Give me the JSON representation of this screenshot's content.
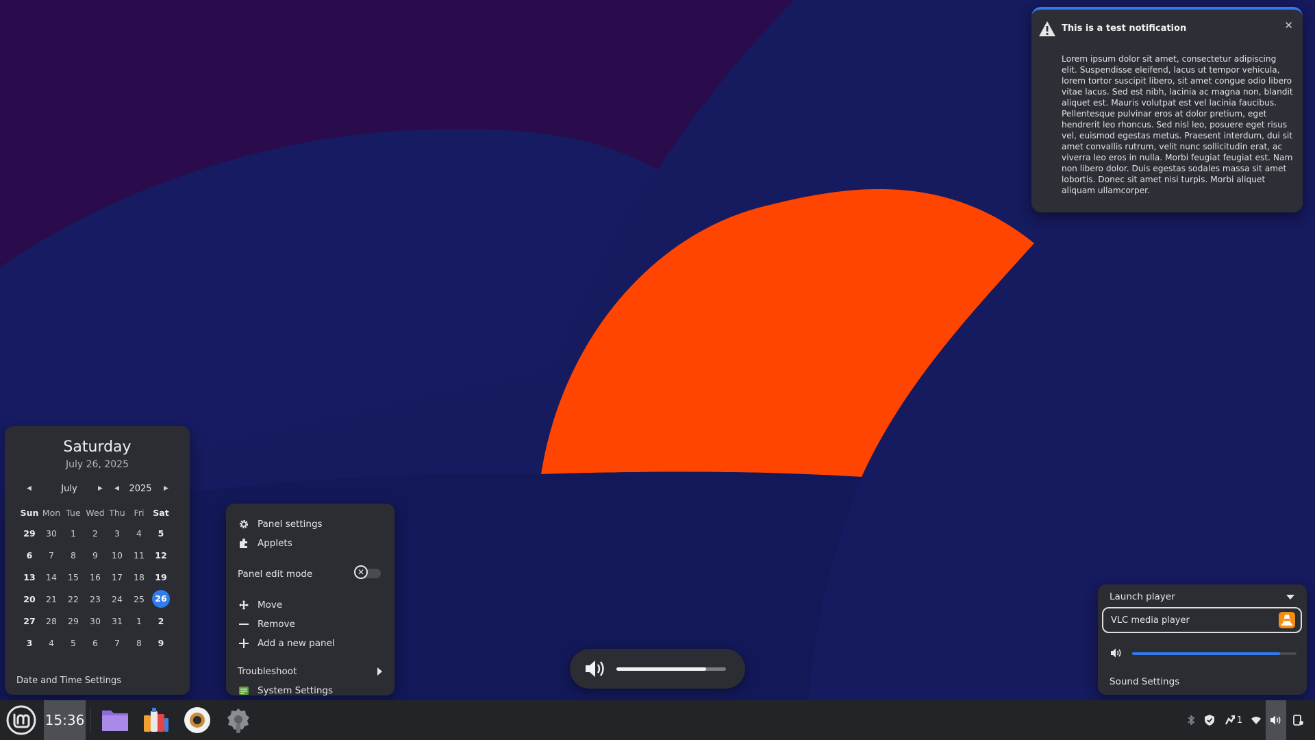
{
  "notification": {
    "title": "This is a test notification",
    "close": "✕",
    "body": "Lorem ipsum dolor sit amet, consectetur adipiscing elit. Suspendisse eleifend, lacus ut tempor vehicula, lorem tortor suscipit libero, sit amet congue odio libero vitae lacus. Sed est nibh, lacinia ac magna non, blandit aliquet est. Mauris volutpat est vel lacinia faucibus. Pellentesque pulvinar eros at dolor pretium, eget hendrerit leo rhoncus. Sed nisl leo, posuere eget risus vel, euismod egestas metus. Praesent interdum, dui sit amet convallis rutrum, velit nunc sollicitudin erat, ac viverra leo eros in nulla. Morbi feugiat feugiat est. Nam non libero dolor. Duis egestas sodales massa sit amet lobortis. Donec sit amet nisi turpis. Morbi aliquet aliquam ullamcorper.",
    "accent": "#2f7cf0"
  },
  "calendar": {
    "weekday": "Saturday",
    "date": "July 26, 2025",
    "month": "July",
    "year": "2025",
    "day_headers": [
      "Sun",
      "Mon",
      "Tue",
      "Wed",
      "Thu",
      "Fri",
      "Sat"
    ],
    "weeks": [
      [
        "29",
        "30",
        "1",
        "2",
        "3",
        "4",
        "5"
      ],
      [
        "6",
        "7",
        "8",
        "9",
        "10",
        "11",
        "12"
      ],
      [
        "13",
        "14",
        "15",
        "16",
        "17",
        "18",
        "19"
      ],
      [
        "20",
        "21",
        "22",
        "23",
        "24",
        "25",
        "26"
      ],
      [
        "27",
        "28",
        "29",
        "30",
        "31",
        "1",
        "2"
      ],
      [
        "3",
        "4",
        "5",
        "6",
        "7",
        "8",
        "9"
      ]
    ],
    "today": "26",
    "footer": "Date and Time Settings"
  },
  "panel_menu": {
    "panel_settings": "Panel settings",
    "applets": "Applets",
    "panel_edit_mode": "Panel edit mode",
    "move": "Move",
    "remove": "Remove",
    "add_panel": "Add a new panel",
    "troubleshoot": "Troubleshoot",
    "system_settings": "System Settings"
  },
  "osd": {
    "volume_level": 0.82
  },
  "sound_applet": {
    "launch_player": "Launch player",
    "player": "VLC media player",
    "volume_level": 0.9,
    "settings": "Sound Settings"
  },
  "taskbar": {
    "clock": "15:36",
    "network_count": "1",
    "icons": [
      "mint-menu-icon",
      "folder-icon",
      "software-manager-icon",
      "disk-usage-icon",
      "settings-icon",
      "bluetooth-icon",
      "shield-icon",
      "update-icon",
      "wifi-icon",
      "volume-icon",
      "notification-icon"
    ]
  }
}
